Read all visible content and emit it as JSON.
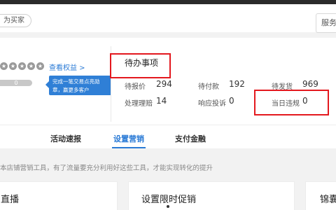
{
  "header": {
    "buyer_tag": "为买家",
    "service_button": "服务"
  },
  "shop": {
    "stars": [
      "★",
      "★",
      "★",
      "★",
      "★"
    ],
    "rights_link": "查看权益 >",
    "progress_value": "0",
    "tooltip_text": "完成一笔交易点亮勋章，赢更多客户"
  },
  "todo": {
    "title": "待办事项",
    "items": [
      {
        "label": "待报价",
        "value": "294"
      },
      {
        "label": "待付款",
        "value": "192"
      },
      {
        "label": "待发货",
        "value": "969"
      },
      {
        "label": "处理理赔",
        "value": "14"
      },
      {
        "label": "响应投诉",
        "value": "0"
      },
      {
        "label": "当日违规",
        "value": "0"
      }
    ]
  },
  "tabs": [
    "活动速报",
    "设置营销",
    "支付金融"
  ],
  "active_tab": "设置营销",
  "tip": "本店铺营销工具，有了流量要充分利用好这些工具，才能实现转化的提升",
  "cards": [
    "直播",
    "设置限时促销",
    "锦囊"
  ],
  "colors": {
    "accent": "#2b7bd6",
    "highlight_box": "#e3181e",
    "tooltip_bg": "#2f7fd6"
  }
}
